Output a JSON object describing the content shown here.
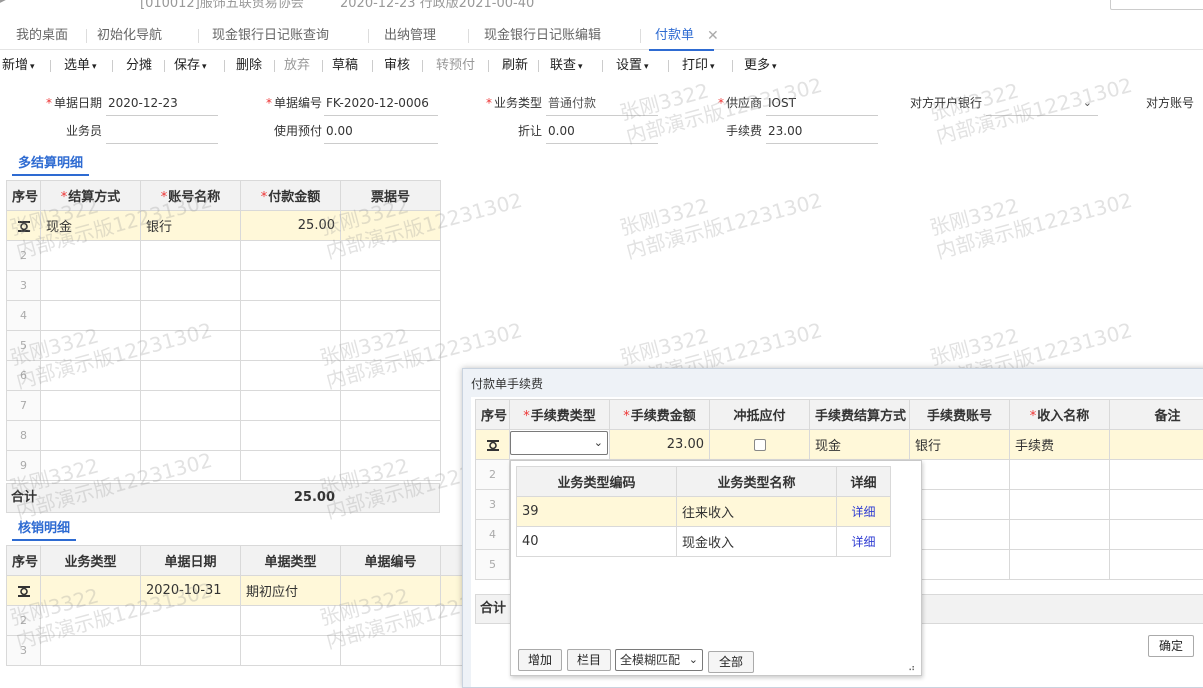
{
  "top_strip": {
    "fragment1": "[010012]服饰五联贸易协会",
    "fragment2": "2020-12-23    行政版2021-00-40"
  },
  "tabs": [
    {
      "label": "我的桌面"
    },
    {
      "label": "初始化导航"
    },
    {
      "label": "现金银行日记账查询"
    },
    {
      "label": "出纳管理"
    },
    {
      "label": "现金银行日记账编辑"
    },
    {
      "label": "付款单",
      "active": true
    }
  ],
  "toolbar": {
    "items": [
      {
        "label": "新增",
        "caret": true
      },
      {
        "label": "选单",
        "caret": true
      },
      {
        "label": "分摊"
      },
      {
        "label": "保存",
        "caret": true
      },
      {
        "label": "删除"
      },
      {
        "label": "放弃",
        "disabled": true
      },
      {
        "label": "草稿"
      },
      {
        "label": "审核"
      },
      {
        "label": "转预付",
        "disabled": true
      },
      {
        "label": "刷新"
      },
      {
        "label": "联查",
        "caret": true
      },
      {
        "label": "设置",
        "caret": true
      },
      {
        "label": "打印",
        "caret": true
      },
      {
        "label": "更多",
        "caret": true
      }
    ]
  },
  "header_form": {
    "doc_date_label": "单据日期",
    "doc_date": "2020-12-23",
    "doc_no_label": "单据编号",
    "doc_no": "FK-2020-12-0006",
    "biz_type_label": "业务类型",
    "biz_type": "普通付款",
    "supplier_label": "供应商",
    "supplier": "IOST",
    "counter_bank_label": "对方开户银行",
    "counter_bank": "",
    "counter_acct_label": "对方账号",
    "salesman_label": "业务员",
    "salesman": "",
    "use_prepay_label": "使用预付",
    "use_prepay": "0.00",
    "discount_label": "折让",
    "discount": "0.00",
    "fee_label": "手续费",
    "fee": "23.00"
  },
  "settlement": {
    "title": "多结算明细",
    "columns": [
      "序号",
      "结算方式",
      "账号名称",
      "付款金额",
      "票据号"
    ],
    "required": [
      false,
      true,
      true,
      true,
      false
    ],
    "rows": [
      [
        "",
        "现金",
        "银行",
        "25.00",
        ""
      ]
    ],
    "empty_rows": [
      "2",
      "3",
      "4",
      "5",
      "6",
      "7",
      "8",
      "9"
    ],
    "total_label": "合计",
    "total": "25.00"
  },
  "writeoff": {
    "title": "核销明细",
    "columns": [
      "序号",
      "业务类型",
      "单据日期",
      "单据类型",
      "单据编号"
    ],
    "rows": [
      [
        "",
        "",
        "2020-10-31",
        "期初应付",
        ""
      ]
    ],
    "empty_rows": [
      "2",
      "3"
    ]
  },
  "fee_dialog": {
    "title": "付款单手续费",
    "columns": [
      "序号",
      "手续费类型",
      "手续费金额",
      "冲抵应付",
      "手续费结算方式",
      "手续费账号",
      "收入名称",
      "备注"
    ],
    "required": [
      false,
      true,
      true,
      false,
      false,
      false,
      true,
      false
    ],
    "row": {
      "fee_type": "",
      "amount": "23.00",
      "settle": "现金",
      "account": "银行",
      "income": "手续费",
      "remark": ""
    },
    "empty_rows": [
      "2",
      "3",
      "4",
      "5"
    ],
    "total_label": "合计",
    "confirm_label": "确定"
  },
  "fee_type_popup": {
    "columns": [
      "业务类型编码",
      "业务类型名称",
      "详细"
    ],
    "rows": [
      {
        "code": "39",
        "name": "往来收入",
        "detail": "详细"
      },
      {
        "code": "40",
        "name": "现金收入",
        "detail": "详细"
      }
    ],
    "add_label": "增加",
    "columns_label": "栏目",
    "match_mode": "全模糊匹配",
    "all_label": "全部"
  },
  "watermark": {
    "line1": "张刚3322",
    "line2": "内部演示版12231302"
  },
  "colors": {
    "accent": "#2e6bd2",
    "selected_row": "#fff8d9",
    "required": "#e33333"
  }
}
